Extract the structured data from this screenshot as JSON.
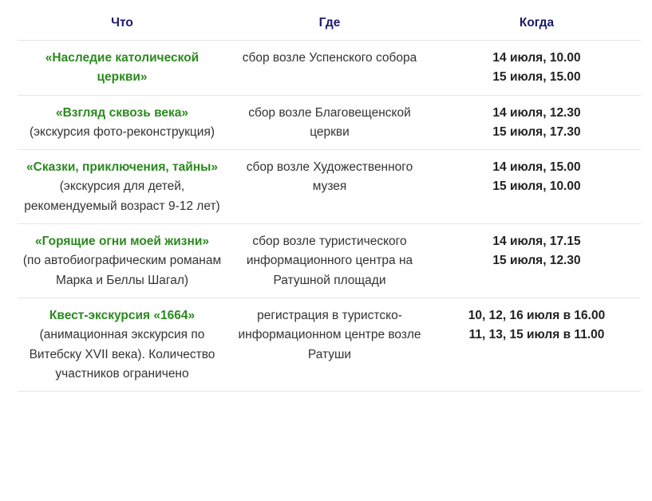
{
  "headers": {
    "what": "Что",
    "where": "Где",
    "when": "Когда"
  },
  "rows": [
    {
      "title": "«Наследие католической церкви»",
      "note": "",
      "where": "сбор возле Успенского собора",
      "when": [
        "14 июля, 10.00",
        "15 июля, 15.00"
      ]
    },
    {
      "title": "«Взгляд сквозь века»",
      "note": "(экскурсия фото-реконструкция)",
      "where": "сбор возле Благовещенской церкви",
      "when": [
        "14 июля, 12.30",
        "15 июля, 17.30"
      ]
    },
    {
      "title": "«Сказки, приключения, тайны»",
      "note": "(экскурсия для детей, рекомендуемый возраст 9-12 лет)",
      "where": "сбор возле Художественного музея",
      "when": [
        "14 июля, 15.00",
        "15 июля, 10.00"
      ]
    },
    {
      "title": "«Горящие огни моей жизни»",
      "note": "(по автобиографическим романам Марка и Беллы Шагал)",
      "where": "сбор возле туристического информационного центра на Ратушной площади",
      "when": [
        "14 июля, 17.15",
        "15 июля, 12.30"
      ]
    },
    {
      "title": "Квест-экскурсия «1664»",
      "note": "(анимационная экскурсия по Витебску XVII века). Количество участников ограничено",
      "where": "регистрация в туристско-информационном центре возле Ратуши",
      "when": [
        "10, 12, 16 июля в 16.00",
        "11, 13, 15 июля в 11.00"
      ]
    }
  ],
  "colors": {
    "header": "#1a1a6e",
    "title": "#2a8a1e",
    "text": "#333333",
    "divider": "#e6e6e6"
  }
}
